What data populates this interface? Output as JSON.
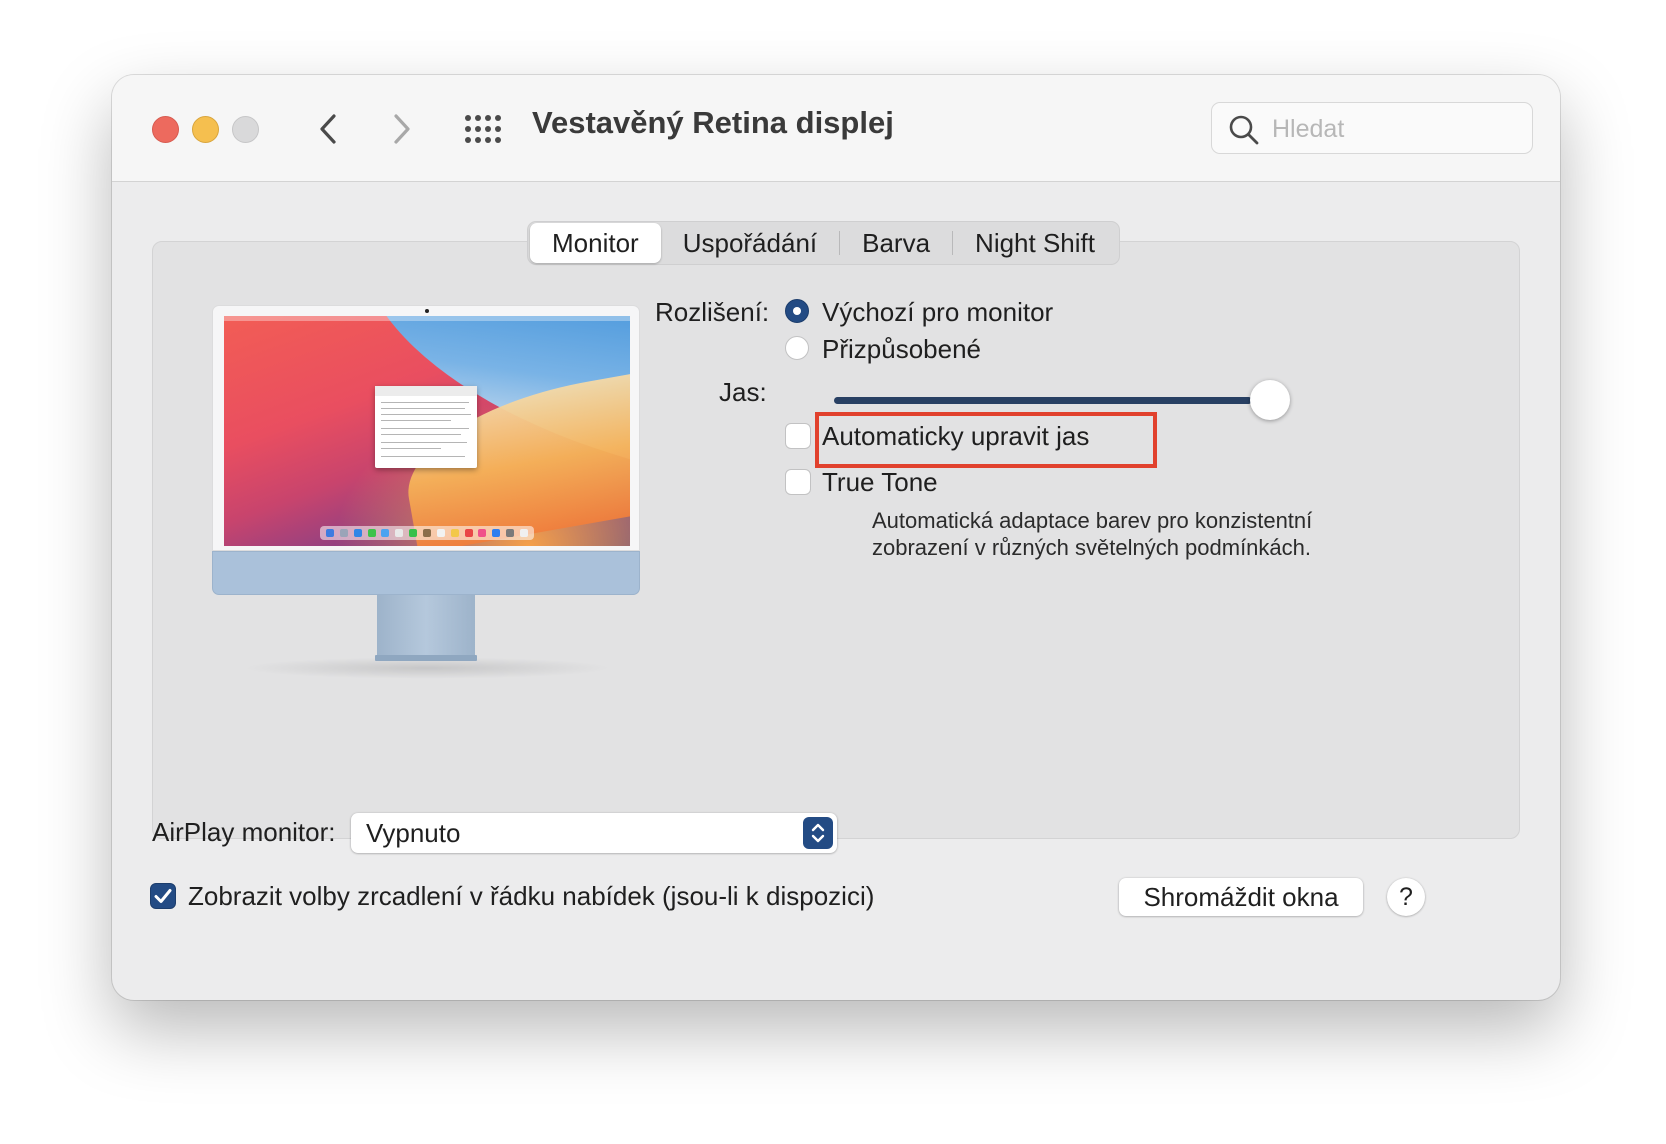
{
  "window": {
    "title": "Vestavěný Retina displej",
    "search_placeholder": "Hledat"
  },
  "tabs": [
    {
      "label": "Monitor",
      "active": true
    },
    {
      "label": "Uspořádání",
      "active": false
    },
    {
      "label": "Barva",
      "active": false
    },
    {
      "label": "Night Shift",
      "active": false
    }
  ],
  "display": {
    "resolution_label": "Rozlišení:",
    "resolution_options": [
      {
        "label": "Výchozí pro monitor",
        "selected": true
      },
      {
        "label": "Přizpůsobené",
        "selected": false
      }
    ],
    "brightness_label": "Jas:",
    "brightness_level": 0.94,
    "auto_brightness_label": "Automaticky upravit jas",
    "auto_brightness_checked": false,
    "true_tone_label": "True Tone",
    "true_tone_checked": false,
    "true_tone_description_line1": "Automatická adaptace barev pro konzistentní",
    "true_tone_description_line2": "zobrazení v různých světelných podmínkách."
  },
  "airplay": {
    "label": "AirPlay monitor:",
    "value": "Vypnuto"
  },
  "mirroring_option": {
    "label": "Zobrazit volby zrcadlení v řádku nabídek (jsou-li k dispozici)",
    "checked": true
  },
  "buttons": {
    "gather_windows": "Shromáždit okna",
    "help": "?"
  },
  "colors": {
    "accent": "#234b84",
    "highlight_box": "#e1412d",
    "traffic_close": "#ed6a5e",
    "traffic_minimize": "#f5bf4f",
    "traffic_zoom_disabled": "#d9d9da"
  },
  "icons": {
    "back": "chevron-left-icon",
    "forward": "chevron-right-icon",
    "show_all": "grid-icon",
    "search": "magnifier-icon",
    "stepper": "up-down-chevron-icon",
    "check": "checkmark-icon"
  }
}
